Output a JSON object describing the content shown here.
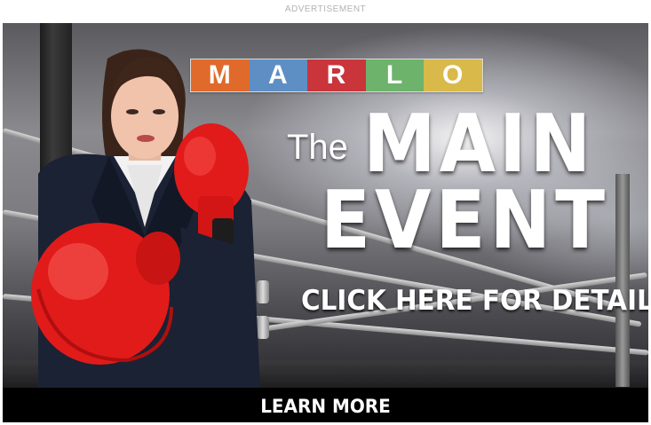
{
  "ad": {
    "label": "ADVERTISEMENT",
    "brand_logo": {
      "letters": [
        "M",
        "A",
        "R",
        "L",
        "O"
      ],
      "colors": [
        "#e06a2b",
        "#5e8fc4",
        "#c9353a",
        "#6db36b",
        "#d8b94a"
      ]
    },
    "headline": {
      "prefix": "The",
      "line1": "MAIN",
      "line2": "EVENT"
    },
    "cta_text": "CLICK HERE FOR DETAILS",
    "learn_more": "LEARN MORE"
  },
  "colors": {
    "glove_red": "#e11a1a",
    "cta_bar": "#000000"
  }
}
